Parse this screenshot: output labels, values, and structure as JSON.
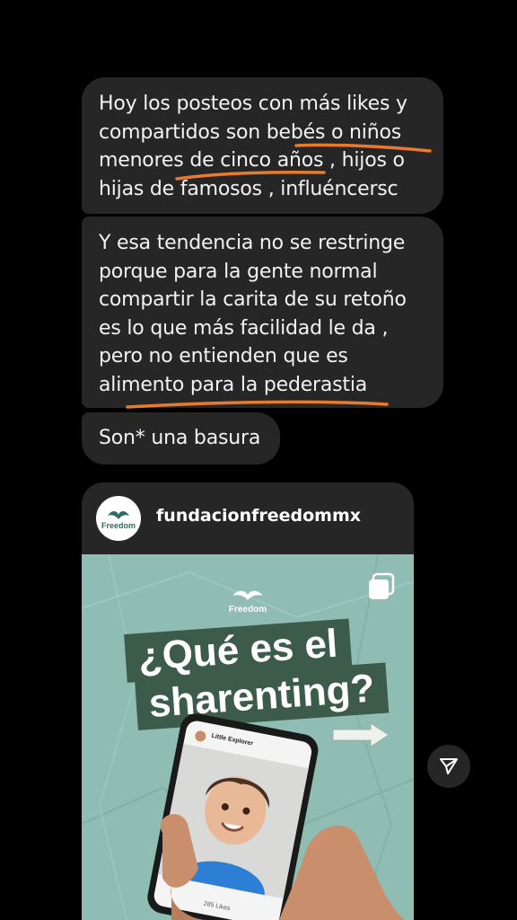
{
  "messages": [
    {
      "lines": [
        "Hoy los posteos con más likes y",
        "compartidos son bebés o niños",
        "menores de cinco años , hijos o",
        "hijas de famosos , influéncersc"
      ]
    },
    {
      "lines": [
        "Y esa tendencia no se restringe",
        "porque para la gente normal",
        "compartir la carita de su retoño",
        "es lo que más facilidad le da ,",
        "pero no entienden que es",
        "alimento para la pederastia"
      ]
    },
    {
      "lines": [
        "Son* una basura"
      ]
    }
  ],
  "shared_post": {
    "username": "fundacionfreedommx",
    "avatar_logo_text": "Freedom",
    "image": {
      "logo_text": "Freedom",
      "title_line1": "¿Qué es el",
      "title_line2": "sharenting?",
      "phone_profile_name": "Little Explorer",
      "phone_likes": "285 Likes"
    }
  },
  "icons": {
    "share": "paper-plane-icon",
    "multi_image": "carousel-icon",
    "arrow": "right-arrow-icon"
  },
  "colors": {
    "bubble": "#262626",
    "underline": "#e87a2c",
    "post_background": "#8fbcb3",
    "title_box": "#3c5b4b"
  }
}
